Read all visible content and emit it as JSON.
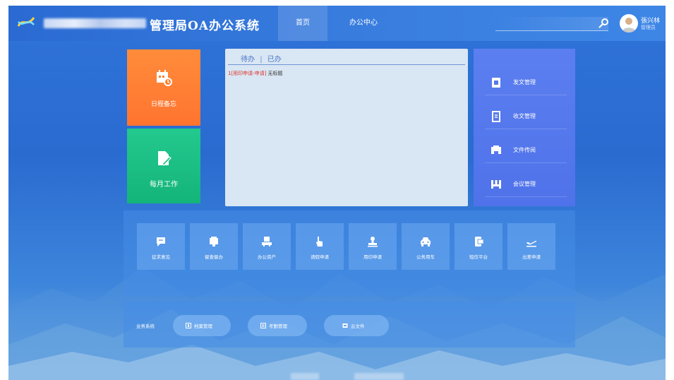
{
  "header": {
    "app_title": "管理局OA办公系统",
    "nav": [
      {
        "label": "首页"
      },
      {
        "label": "办公中心"
      }
    ],
    "user": {
      "name": "張兴林",
      "role": "管理员"
    }
  },
  "tiles": {
    "schedule_label": "日程备忘",
    "monthly_label": "每月工作"
  },
  "todo": {
    "tabs": [
      "待办",
      "已办"
    ],
    "separator": "|",
    "items": [
      {
        "tag": "1[用印申请-申请]",
        "text": "无标题"
      }
    ]
  },
  "management": [
    {
      "label": "发文管理",
      "icon": "document-icon"
    },
    {
      "label": "收文管理",
      "icon": "receipt-icon"
    },
    {
      "label": "文件传阅",
      "icon": "file-circulate-icon"
    },
    {
      "label": "会议管理",
      "icon": "meeting-icon"
    }
  ],
  "apps": [
    {
      "label": "征求意见",
      "icon": "comment-icon"
    },
    {
      "label": "督查督办",
      "icon": "supervise-icon"
    },
    {
      "label": "办公资产",
      "icon": "asset-icon"
    },
    {
      "label": "请假申请",
      "icon": "leave-icon"
    },
    {
      "label": "用印申请",
      "icon": "seal-icon"
    },
    {
      "label": "公务用车",
      "icon": "car-icon"
    },
    {
      "label": "短信平台",
      "icon": "sms-icon"
    },
    {
      "label": "出差申请",
      "icon": "plane-icon"
    }
  ],
  "business": {
    "title": "业务系统",
    "items": [
      {
        "label": "档案管理",
        "icon": "archive-icon"
      },
      {
        "label": "考勤管理",
        "icon": "attendance-icon"
      },
      {
        "label": "云文件",
        "icon": "cloud-file-icon"
      }
    ]
  },
  "colors": {
    "header": "#3a7fe0",
    "orange_tile": "#ff8030",
    "green_tile": "#1bbe82",
    "mgmt_panel": "#5578ee",
    "todo_panel": "#d9e6f3",
    "todo_tag": "#e0322c"
  }
}
